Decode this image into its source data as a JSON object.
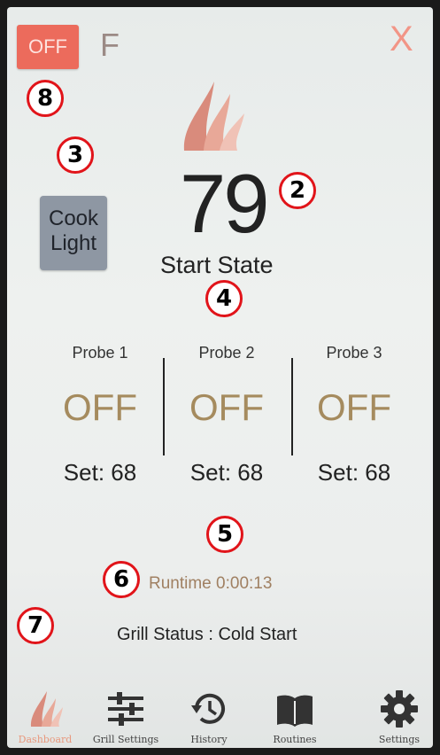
{
  "header": {
    "power_label": "OFF",
    "unit_label": "F",
    "close_label": "X"
  },
  "main": {
    "temperature": "79",
    "state": "Start State",
    "cook_light_label_line1": "Cook",
    "cook_light_label_line2": "Light"
  },
  "probes": [
    {
      "name": "Probe 1",
      "value": "OFF",
      "set": "Set: 68"
    },
    {
      "name": "Probe 2",
      "value": "OFF",
      "set": "Set: 68"
    },
    {
      "name": "Probe 3",
      "value": "OFF",
      "set": "Set: 68"
    }
  ],
  "runtime": "Runtime 0:00:13",
  "grill_status": "Grill Status :  Cold Start",
  "callouts": [
    "8",
    "3",
    "2",
    "4",
    "5",
    "6",
    "7"
  ],
  "nav": {
    "items": [
      {
        "label": "Dashboard",
        "icon": "flame-icon"
      },
      {
        "label": "Grill Settings",
        "icon": "sliders-icon"
      },
      {
        "label": "History",
        "icon": "history-icon"
      },
      {
        "label": "Routines",
        "icon": "book-icon"
      },
      {
        "label": "Settings",
        "icon": "gear-icon"
      }
    ]
  },
  "colors": {
    "power_button": "#ec6b5c",
    "probe_off": "#a58b5e",
    "active_nav": "#e8987d",
    "callout_ring": "#e1141a"
  }
}
